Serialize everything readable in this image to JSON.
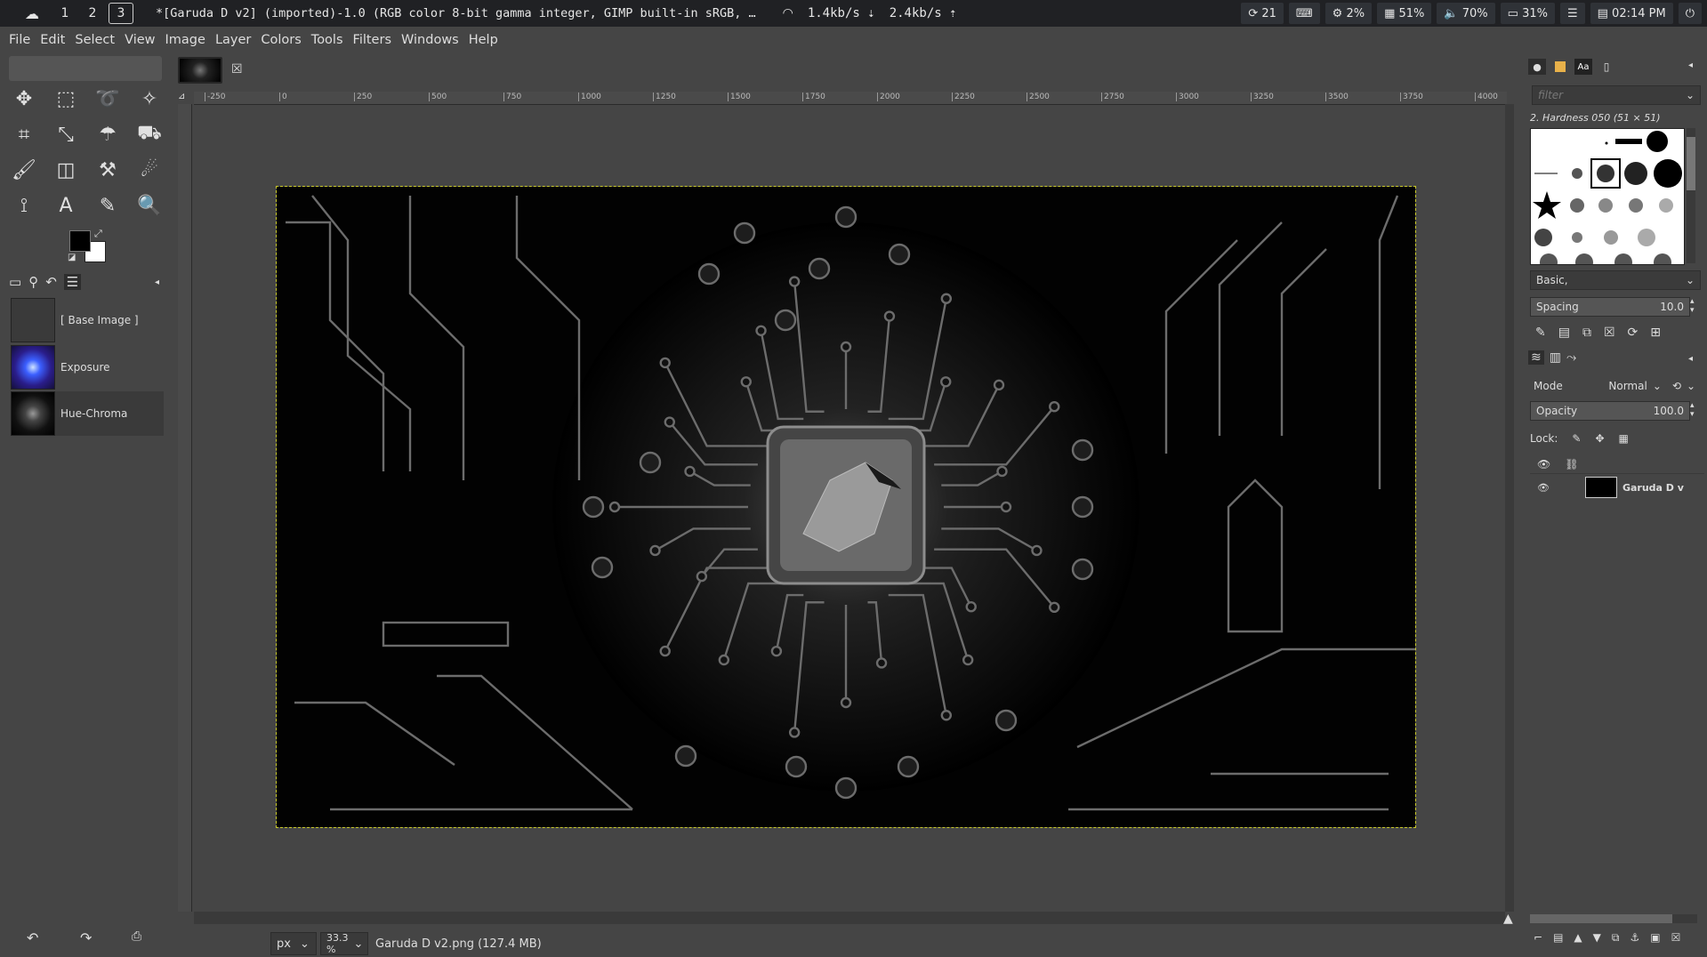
{
  "system_bar": {
    "workspaces": [
      "1",
      "2",
      "3"
    ],
    "active_workspace": "3",
    "window_title": "*[Garuda D v2] (imported)-1.0 (RGB color 8-bit gamma integer, GIMP built-in sRGB, …",
    "net_down": "1.4kb/s ⇣",
    "net_up": "2.4kb/s ⇡",
    "updates": "21",
    "cpu": "2%",
    "memory": "51%",
    "volume": "70%",
    "battery": "31%",
    "clock": "02:14 PM"
  },
  "menu": [
    "File",
    "Edit",
    "Select",
    "View",
    "Image",
    "Layer",
    "Colors",
    "Tools",
    "Filters",
    "Windows",
    "Help"
  ],
  "toolbox": {
    "icons": [
      "move-tool-icon",
      "rect-select-icon",
      "lasso-icon",
      "fuzzy-select-icon",
      "crop-icon",
      "transform-icon",
      "warp-icon",
      "bucket-fill-icon",
      "paintbrush-icon",
      "eraser-icon",
      "clone-icon",
      "smudge-icon",
      "path-icon",
      "text-icon",
      "color-picker-icon",
      "zoom-icon"
    ],
    "glyphs": [
      "✥",
      "⬚",
      "➰",
      "✧",
      "⌗",
      "⤡",
      "☂",
      "⛟",
      "🖌",
      "◫",
      "⚒",
      "☄",
      "⟟",
      "A",
      "✎",
      "🔍"
    ]
  },
  "layers_panel": {
    "items": [
      {
        "label": "[ Base Image ]"
      },
      {
        "label": "Exposure"
      },
      {
        "label": "Hue-Chroma"
      }
    ]
  },
  "ruler_ticks": [
    "-250",
    "0",
    "250",
    "500",
    "750",
    "1000",
    "1250",
    "1500",
    "1750",
    "2000",
    "2250",
    "2500",
    "2750",
    "3000",
    "3250",
    "3500",
    "3750",
    "4000"
  ],
  "status": {
    "unit": "px",
    "zoom": "33.3 %",
    "file_info": "Garuda D v2.png (127.4 MB)"
  },
  "brushes": {
    "filter_placeholder": "filter",
    "current": "2. Hardness 050 (51 × 51)",
    "preset": "Basic,",
    "spacing_label": "Spacing",
    "spacing_value": "10.0"
  },
  "layer_dock": {
    "mode_label": "Mode",
    "mode_value": "Normal",
    "opacity_label": "Opacity",
    "opacity_value": "100.0",
    "lock_label": "Lock:",
    "layer_name": "Garuda D v"
  },
  "colors": {
    "fg": "#000000",
    "bg": "#ffffff",
    "accent": "#c9c92a"
  }
}
